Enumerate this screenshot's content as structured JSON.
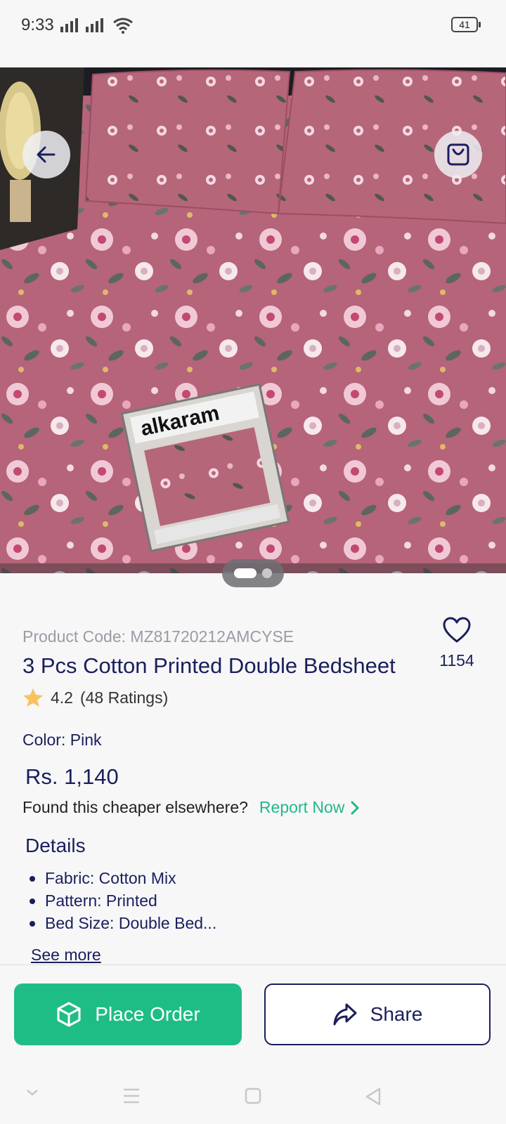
{
  "status": {
    "time": "9:33",
    "battery": "41"
  },
  "product": {
    "code_label": "Product Code: ",
    "code": "MZ81720212AMCYSE",
    "title": "3 Pcs Cotton Printed Double Bedsheet",
    "favorites": "1154",
    "rating": "4.2",
    "ratings_count": "(48 Ratings)",
    "color_label": "Color:",
    "color_value": "Pink",
    "price": "Rs. 1,140",
    "image_count": 2,
    "image_active": 1,
    "box_brand": "alkaram"
  },
  "report": {
    "question": "Found this cheaper elsewhere?",
    "link": "Report Now"
  },
  "details": {
    "title": "Details",
    "items": [
      "Fabric: Cotton Mix",
      "Pattern: Printed",
      "Bed Size: Double Bed..."
    ],
    "see_more": "See more"
  },
  "actions": {
    "place_order": "Place Order",
    "share": "Share"
  },
  "colors": {
    "accent_green": "#1fbd86",
    "navy": "#1a1f5c",
    "product_pink": "#b06074"
  },
  "icons": [
    "back-arrow-icon",
    "shopping-bag-icon",
    "heart-icon",
    "star-icon",
    "chevron-right-icon",
    "box-icon",
    "share-icon"
  ]
}
